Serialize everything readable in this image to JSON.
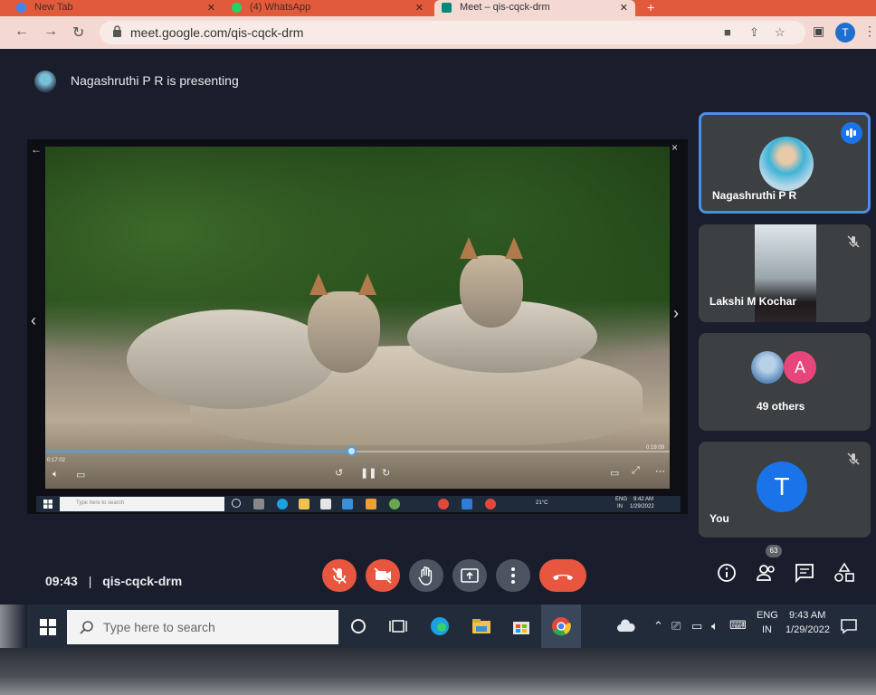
{
  "browser": {
    "tabs": [
      {
        "label": "New Tab",
        "favicon_color": "#4285f4"
      },
      {
        "label": "(4) WhatsApp",
        "favicon_color": "#25d366"
      },
      {
        "label": "Meet – qis-cqck-drm",
        "favicon_color": "#00897b"
      }
    ],
    "new_tab_symbol": "+",
    "close_symbol": "✕",
    "url": "meet.google.com/qis-cqck-drm",
    "profile_initial": "T"
  },
  "meet": {
    "presenting_label": "Nagashruthi P R is presenting",
    "meeting_time": "09:43",
    "separator": "|",
    "meeting_code": "qis-cqck-drm",
    "participant_count": "63",
    "accent_color": "#1a73e8",
    "danger_color": "#e8563f"
  },
  "presented_screen": {
    "time_elapsed": "0:17:02",
    "time_total": "0:19:09",
    "progress": 0.49,
    "mini_search_placeholder": "Type here to search",
    "weather": "21°C",
    "lang": "ENG",
    "region": "IN",
    "clock": "9:42 AM",
    "date": "1/29/2022"
  },
  "tiles": [
    {
      "name": "Nagashruthi P R",
      "speaking": true
    },
    {
      "name": "Lakshi M Kochar",
      "muted": true
    },
    {
      "name": "49 others",
      "avatar_letter": "A",
      "avatar_color": "#e8457a"
    },
    {
      "name": "You",
      "avatar_letter": "T",
      "avatar_color": "#1a73e8",
      "muted": true
    }
  ],
  "taskbar": {
    "search_placeholder": "Type here to search",
    "lang": "ENG",
    "region": "IN",
    "clock": "9:43 AM",
    "date": "1/29/2022"
  }
}
